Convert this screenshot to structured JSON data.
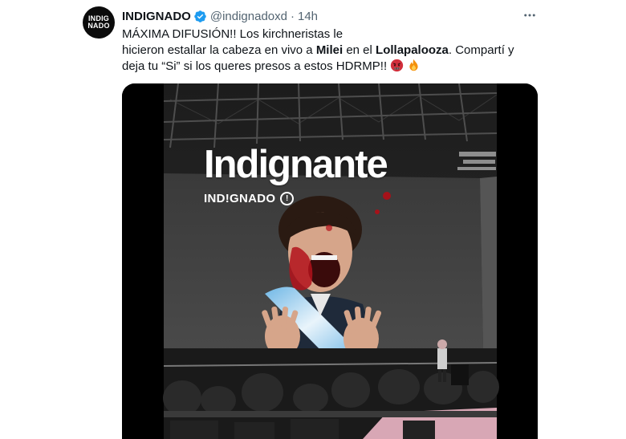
{
  "tweet": {
    "avatar": {
      "line1": "INDIG",
      "line2": "NADO"
    },
    "author_name": "INDIGNADO",
    "handle": "@indignadoxd",
    "separator": "·",
    "time": "14h",
    "more_icon": "more-dots-icon",
    "text": {
      "line1": "MÁXIMA DIFUSIÓN!! Los kirchneristas le",
      "line2_part1": "hicieron estallar la cabeza en vivo a ",
      "line2_bold1": "Milei",
      "line2_part2": " en el ",
      "line2_bold2": "Lollapalooza",
      "line2_part3": ". Compartí y",
      "line3": "deja tu “Si” si los queres presos a estos HDRMP!!",
      "emojis": [
        "angry-face-emoji",
        "fire-emoji"
      ]
    },
    "media": {
      "overlay_title": "Indignante",
      "overlay_brand": "IND!GNADO",
      "overlay_info_glyph": "!"
    }
  },
  "colors": {
    "text_primary": "#0f1419",
    "text_secondary": "#536471",
    "verified_blue": "#1d9bf0",
    "media_bg": "#000000"
  }
}
